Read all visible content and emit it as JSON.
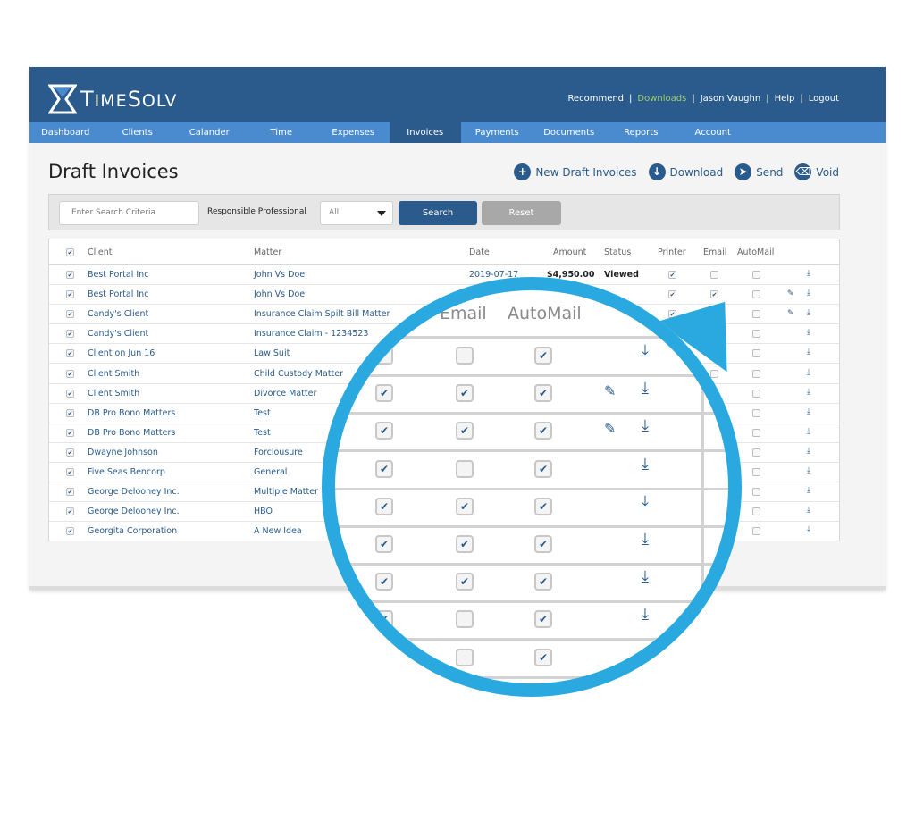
{
  "logo": {
    "text_big": "T",
    "text_rest": "IME",
    "text_big2": "S",
    "text_rest2": "OLV"
  },
  "topnav": {
    "recommend": "Recommend",
    "downloads": "Downloads",
    "user": "Jason Vaughn",
    "help": "Help",
    "logout": "Logout",
    "sep": "|"
  },
  "navbar": [
    "Dashboard",
    "Clients",
    "Calander",
    "Time",
    "Expenses",
    "Invoices",
    "Payments",
    "Documents",
    "Reports",
    "Account"
  ],
  "active_tab": "Invoices",
  "page_title": "Draft Invoices",
  "actions": {
    "new_draft": "New Draft Invoices",
    "download": "Download",
    "send": "Send",
    "void": "Void"
  },
  "filters": {
    "search_placeholder": "Enter Search Criteria",
    "responsible_label": "Responsible Professional",
    "responsible_value": "All",
    "search_button": "Search",
    "reset_button": "Reset"
  },
  "table": {
    "headers": {
      "client": "Client",
      "matter": "Matter",
      "date": "Date",
      "amount": "Amount",
      "status": "Status",
      "printer": "Printer",
      "email": "Email",
      "automail": "AutoMail"
    },
    "check_glyph": "✔",
    "download_glyph": "⤓",
    "note_glyph": "✎",
    "rows": [
      {
        "client": "Best Portal Inc",
        "matter": "John Vs Doe",
        "date": "2019-07-17",
        "amount": "$4,950.00",
        "status": "Viewed"
      },
      {
        "client": "Best Portal Inc",
        "matter": "John Vs Doe",
        "date": "",
        "amount": "",
        "status": ""
      },
      {
        "client": "Candy's Client",
        "matter": "Insurance Claim Spilt Bill Matter",
        "date": "",
        "amount": "",
        "status": ""
      },
      {
        "client": "Candy's Client",
        "matter": "Insurance Claim - 1234523",
        "date": "",
        "amount": "",
        "status": ""
      },
      {
        "client": "Client on Jun 16",
        "matter": "Law Suit",
        "date": "",
        "amount": "",
        "status": ""
      },
      {
        "client": "Client Smith",
        "matter": "Child Custody Matter",
        "date": "",
        "amount": "",
        "status": ""
      },
      {
        "client": "Client Smith",
        "matter": "Divorce Matter",
        "date": "",
        "amount": "",
        "status": ""
      },
      {
        "client": "DB Pro Bono Matters",
        "matter": "Test",
        "date": "",
        "amount": "",
        "status": ""
      },
      {
        "client": "DB Pro Bono Matters",
        "matter": "Test",
        "date": "",
        "amount": "",
        "status": ""
      },
      {
        "client": "Dwayne Johnson",
        "matter": "Forclousure",
        "date": "",
        "amount": "",
        "status": ""
      },
      {
        "client": "Five Seas Bencorp",
        "matter": "General",
        "date": "",
        "amount": "",
        "status": ""
      },
      {
        "client": "George Delooney Inc.",
        "matter": "Multiple Matter",
        "date": "",
        "amount": "",
        "status": ""
      },
      {
        "client": "George Delooney Inc.",
        "matter": "HBO",
        "date": "",
        "amount": "",
        "status": ""
      },
      {
        "client": "Georgita Corporation",
        "matter": "A New Idea",
        "date": "",
        "amount": "",
        "status": ""
      }
    ]
  },
  "magnifier": {
    "email_header": "Email",
    "automail_header": "AutoMail"
  },
  "colors": {
    "brand_dark": "#2a5b8c",
    "nav_blue": "#4a8bd0",
    "accent_green": "#9ecc6a",
    "lens_blue": "#2aa9e0"
  }
}
